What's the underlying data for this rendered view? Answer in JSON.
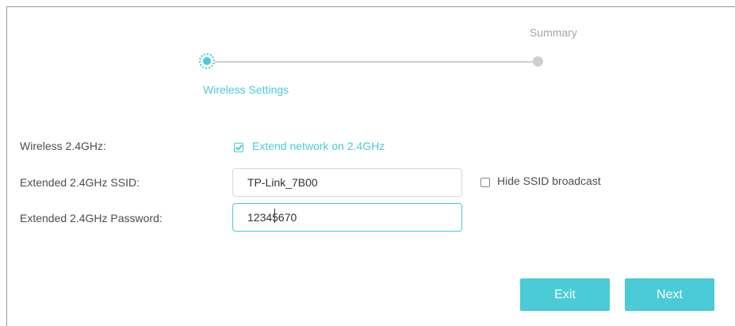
{
  "stepper": {
    "current_step": "Wireless Settings",
    "next_step": "Summary"
  },
  "form": {
    "wireless_24": {
      "label": "Wireless 2.4GHz:",
      "checkbox_label": "Extend network on 2.4GHz",
      "checked": true
    },
    "ssid": {
      "label": "Extended 2.4GHz SSID:",
      "value": "TP-Link_7B00",
      "hide_label": "Hide SSID broadcast",
      "hide_checked": false
    },
    "password": {
      "label": "Extended 2.4GHz Password:",
      "value": "12345670"
    }
  },
  "buttons": {
    "exit": "Exit",
    "next": "Next"
  },
  "colors": {
    "accent": "#4acbd6",
    "label_text": "#4d4d4d",
    "inactive": "#cfcfcf"
  }
}
